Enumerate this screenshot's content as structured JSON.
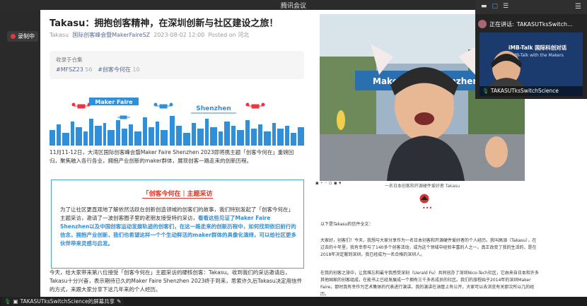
{
  "app": {
    "title": "腾讯会议",
    "recording_badge": "录制中",
    "share_label": "TAKASUTksSwitchScience的屏幕共享"
  },
  "video": {
    "speaking_prefix": "正在讲话:",
    "speaking_name": "TAKASUTksSwitch...",
    "tile_name": "TAKASUTksSwitchScience",
    "slide_line1": "iMB-Talk 国际科创对话",
    "slide_line2": "iMB-Talk with the Makers"
  },
  "doc": {
    "title": "Takasu：拥抱创客精神，在深圳创新与社区建设之旅！",
    "meta_author": "Takasu",
    "meta_source": "国际创客峰会暨MakerFaireSZ",
    "meta_date": "2023-08-02 12:00",
    "meta_posted": "Posted on 河北",
    "collection_label": "收录于合集",
    "tag1": "#MFSZ23",
    "tag1_count": "56",
    "tag2": "#创客今何在",
    "tag2_count": "10",
    "banner_left": "Maker Faire",
    "banner_right": "Shenzhen",
    "para1": "11月11-12日，大湾区国际创客峰会暨Maker Faire Shenzhen 2023即将携主题「创客今何在」重磅回归，聚焦融入各行各业，拥抱产业创新的maker群体，展现创客一路走来的创新历程。",
    "quote_title": "「创客今何在｜主题采访",
    "quote_normal": "为了让社区更直观地了解依然活跃在创新创造领域的创客们的故事，我们特别发起了「创客今何在」主题采访，邀请了一波创客圈子里的老朋友接受特约采访，",
    "quote_blue": "看看这些见证了Maker Faire Shenzhen以及中国创客运动发展轨迹的创客们，在这一路走来的创新历程中，如何找到依旧前行的信念，拥抱产业创新，我们也希望这样一个个生动鲜活的maker群体的具像化演绎，可以给社区更多伙伴带来灵感与启发。",
    "para2": "今天，给大家带来第八位接受「创客今何在」主题采访的硬核创客：Takasu。收到我们的采访邀请后，Takasu十分兴奋，表示期待已久的Maker Faire Shenzhen 2023终于到来，思索许久后Takasu决定用信件的方式，来跟大家分享下这几年来的个人经历。"
  },
  "rdoc": {
    "photo_sign": "Maker Faire Shenzhen",
    "caption": "一名日本创客和开源硬件爱好者 Takasu",
    "dots": "•••",
    "para1": "以下是Takasu的信件全文：",
    "para2": "大家好，创客们！今天，我想与大家分享作为一名日本创客和开源硬件爱好者的个人经历。我叫高須（Takasu），在过去的十年里，我有幸参与了140多个创客活动，成为这个领域中经验丰富的人之一。真正改变了我的生活的，是在2018年决定搬到深圳，我已经成为一名合格的深圳人。",
    "para3": "在我的创客之旅中，让我难忘和最令我感受深刻（Uerald Fu）共同创办了深圳Nico-Tech社区，它由来自日本和许多其他国家的创客组成，在能书上已经发展成一个拥有三千多名成员的社区。我们的旅程始于2014年的深圳Maker Faire，那时我有幸作为艺术集体的代表进行演讲。我的演讲在油管上有公开，大家可以去浏览有关那次所以几的经历。"
  },
  "colors": {
    "accent_blue": "#2f8fd8",
    "quote_red": "#d33322",
    "link_blue": "#576b95"
  }
}
